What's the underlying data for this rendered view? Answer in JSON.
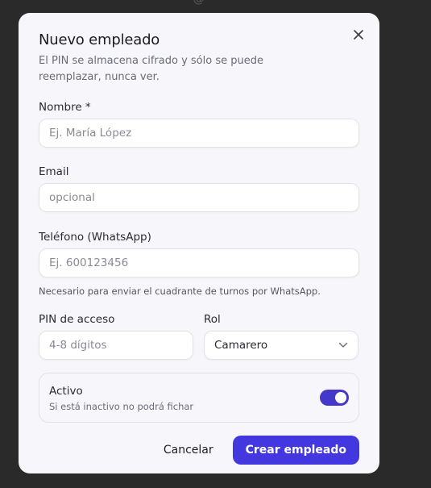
{
  "background": {
    "partial_text": "— · · · · · · · · @ · · ·"
  },
  "modal": {
    "title": "Nuevo empleado",
    "subtitle": "El PIN se almacena cifrado y sólo se puede reemplazar, nunca ver.",
    "close_icon": "close-icon"
  },
  "form": {
    "name": {
      "label": "Nombre *",
      "placeholder": "Ej. María López"
    },
    "email": {
      "label": "Email",
      "placeholder": "opcional"
    },
    "phone": {
      "label": "Teléfono (WhatsApp)",
      "placeholder": "Ej. 600123456",
      "hint": "Necesario para enviar el cuadrante de turnos por WhatsApp."
    },
    "pin": {
      "label": "PIN de acceso",
      "placeholder": "4-8 dígitos"
    },
    "role": {
      "label": "Rol",
      "value": "Camarero",
      "icon": "chevron-down-icon"
    },
    "active": {
      "label": "Activo",
      "description": "Si está inactivo no podrá fichar",
      "enabled": true
    }
  },
  "footer": {
    "cancel_label": "Cancelar",
    "submit_label": "Crear empleado"
  },
  "colors": {
    "accent": "#4338e0",
    "toggle_on": "#4338ca",
    "modal_bg": "#f7f7fb",
    "backdrop": "#2a2a2b"
  }
}
